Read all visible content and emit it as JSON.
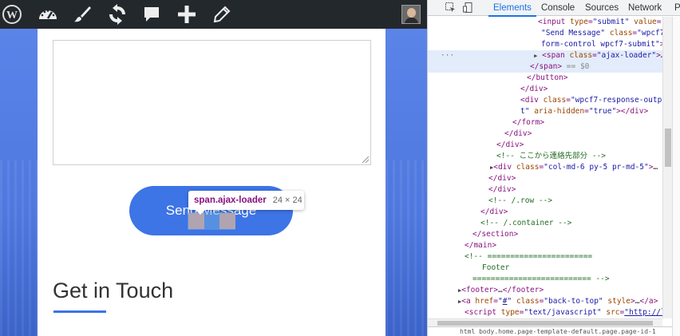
{
  "admin_bar": {
    "icons": [
      "wordpress-icon",
      "dashboard-icon",
      "customize-brush-icon",
      "updates-icon",
      "comments-icon",
      "new-plus-icon",
      "edit-pencil-icon"
    ]
  },
  "page": {
    "send_button_label": "Send Message",
    "tooltip_selector": "span.ajax-loader",
    "tooltip_size": "24 × 24",
    "section_heading": "Get in Touch"
  },
  "devtools": {
    "tabs": [
      "Elements",
      "Console",
      "Sources",
      "Network",
      "Pe"
    ],
    "active_tab": "Elements",
    "breadcrumb": "html  body.home.page-template-default.page.page-id-1"
  },
  "colors": {
    "accent": "#3d74e6",
    "adminbar": "#23282d",
    "tag": "#881280",
    "attr": "#994500",
    "value": "#1a1aa6",
    "comment": "#236e25"
  }
}
